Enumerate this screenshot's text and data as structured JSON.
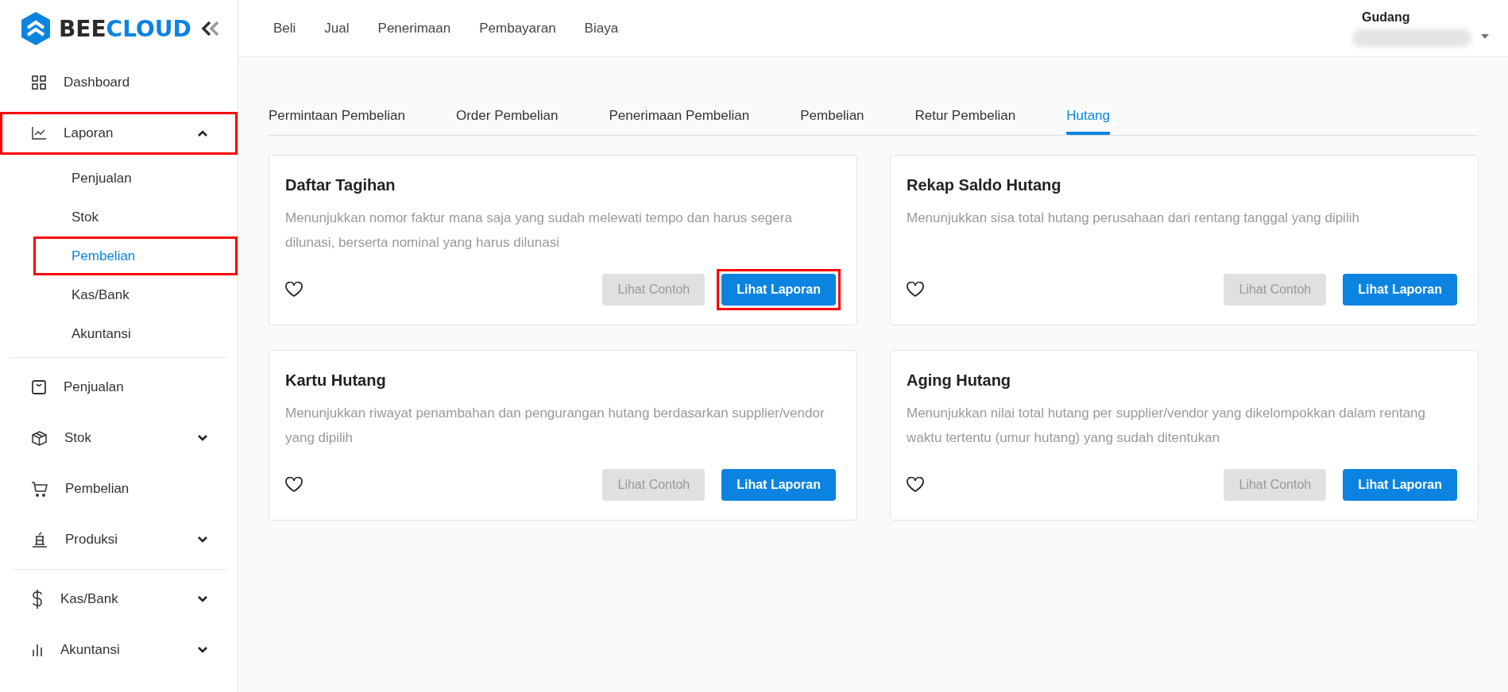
{
  "sidebar": {
    "logo": {
      "dark_part": "BEE",
      "blue_part": "CLOUD"
    },
    "groups": [
      [
        {
          "label": "Dashboard",
          "highlighted": false
        },
        {
          "label": "Laporan",
          "expanded": true,
          "highlighted": true,
          "children": [
            {
              "label": "Penjualan",
              "selected": false,
              "highlighted": false
            },
            {
              "label": "Stok",
              "selected": false,
              "highlighted": false
            },
            {
              "label": "Pembelian",
              "selected": true,
              "highlighted": true
            },
            {
              "label": "Kas/Bank",
              "selected": false,
              "highlighted": false
            },
            {
              "label": "Akuntansi",
              "selected": false,
              "highlighted": false
            }
          ]
        }
      ],
      [
        {
          "label": "Penjualan",
          "highlighted": false
        },
        {
          "label": "Stok",
          "expanded": false,
          "highlighted": false
        },
        {
          "label": "Pembelian",
          "highlighted": false
        },
        {
          "label": "Produksi",
          "expanded": false,
          "highlighted": false
        }
      ],
      [
        {
          "label": "Kas/Bank",
          "expanded": false,
          "highlighted": false
        },
        {
          "label": "Akuntansi",
          "expanded": false,
          "highlighted": false
        }
      ]
    ]
  },
  "top_nav": [
    "Beli",
    "Jual",
    "Penerimaan",
    "Pembayaran",
    "Biaya"
  ],
  "account": {
    "label": "Gudang"
  },
  "tabs": [
    {
      "label": "Permintaan Pembelian",
      "selected": false
    },
    {
      "label": "Order Pembelian",
      "selected": false
    },
    {
      "label": "Penerimaan Pembelian",
      "selected": false
    },
    {
      "label": "Pembelian",
      "selected": false
    },
    {
      "label": "Retur Pembelian",
      "selected": false
    },
    {
      "label": "Hutang",
      "selected": true
    }
  ],
  "cards": [
    {
      "title": "Daftar Tagihan",
      "description": "Menunjukkan nomor faktur mana saja yang sudah melewati tempo dan harus segera dilunasi, berserta nominal yang harus dilunasi",
      "favorite": false,
      "buttons": [
        {
          "label": "Lihat Contoh",
          "disabled": true,
          "highlighted": false
        },
        {
          "label": "Lihat Laporan",
          "disabled": false,
          "highlighted": true
        }
      ]
    },
    {
      "title": "Rekap Saldo Hutang",
      "description": "Menunjukkan sisa total hutang perusahaan dari rentang tanggal yang dipilih",
      "favorite": false,
      "buttons": [
        {
          "label": "Lihat Contoh",
          "disabled": true,
          "highlighted": false
        },
        {
          "label": "Lihat Laporan",
          "disabled": false,
          "highlighted": false
        }
      ]
    },
    {
      "title": "Kartu Hutang",
      "description": "Menunjukkan riwayat penambahan dan pengurangan hutang berdasarkan supplier/vendor yang dipilih",
      "favorite": false,
      "buttons": [
        {
          "label": "Lihat Contoh",
          "disabled": true,
          "highlighted": false
        },
        {
          "label": "Lihat Laporan",
          "disabled": false,
          "highlighted": false
        }
      ]
    },
    {
      "title": "Aging Hutang",
      "description": "Menunjukkan nilai total hutang per supplier/vendor yang dikelompokkan dalam rentang waktu tertentu (umur hutang) yang sudah ditentukan",
      "favorite": false,
      "buttons": [
        {
          "label": "Lihat Contoh",
          "disabled": true,
          "highlighted": false
        },
        {
          "label": "Lihat Laporan",
          "disabled": false,
          "highlighted": false
        }
      ]
    }
  ]
}
